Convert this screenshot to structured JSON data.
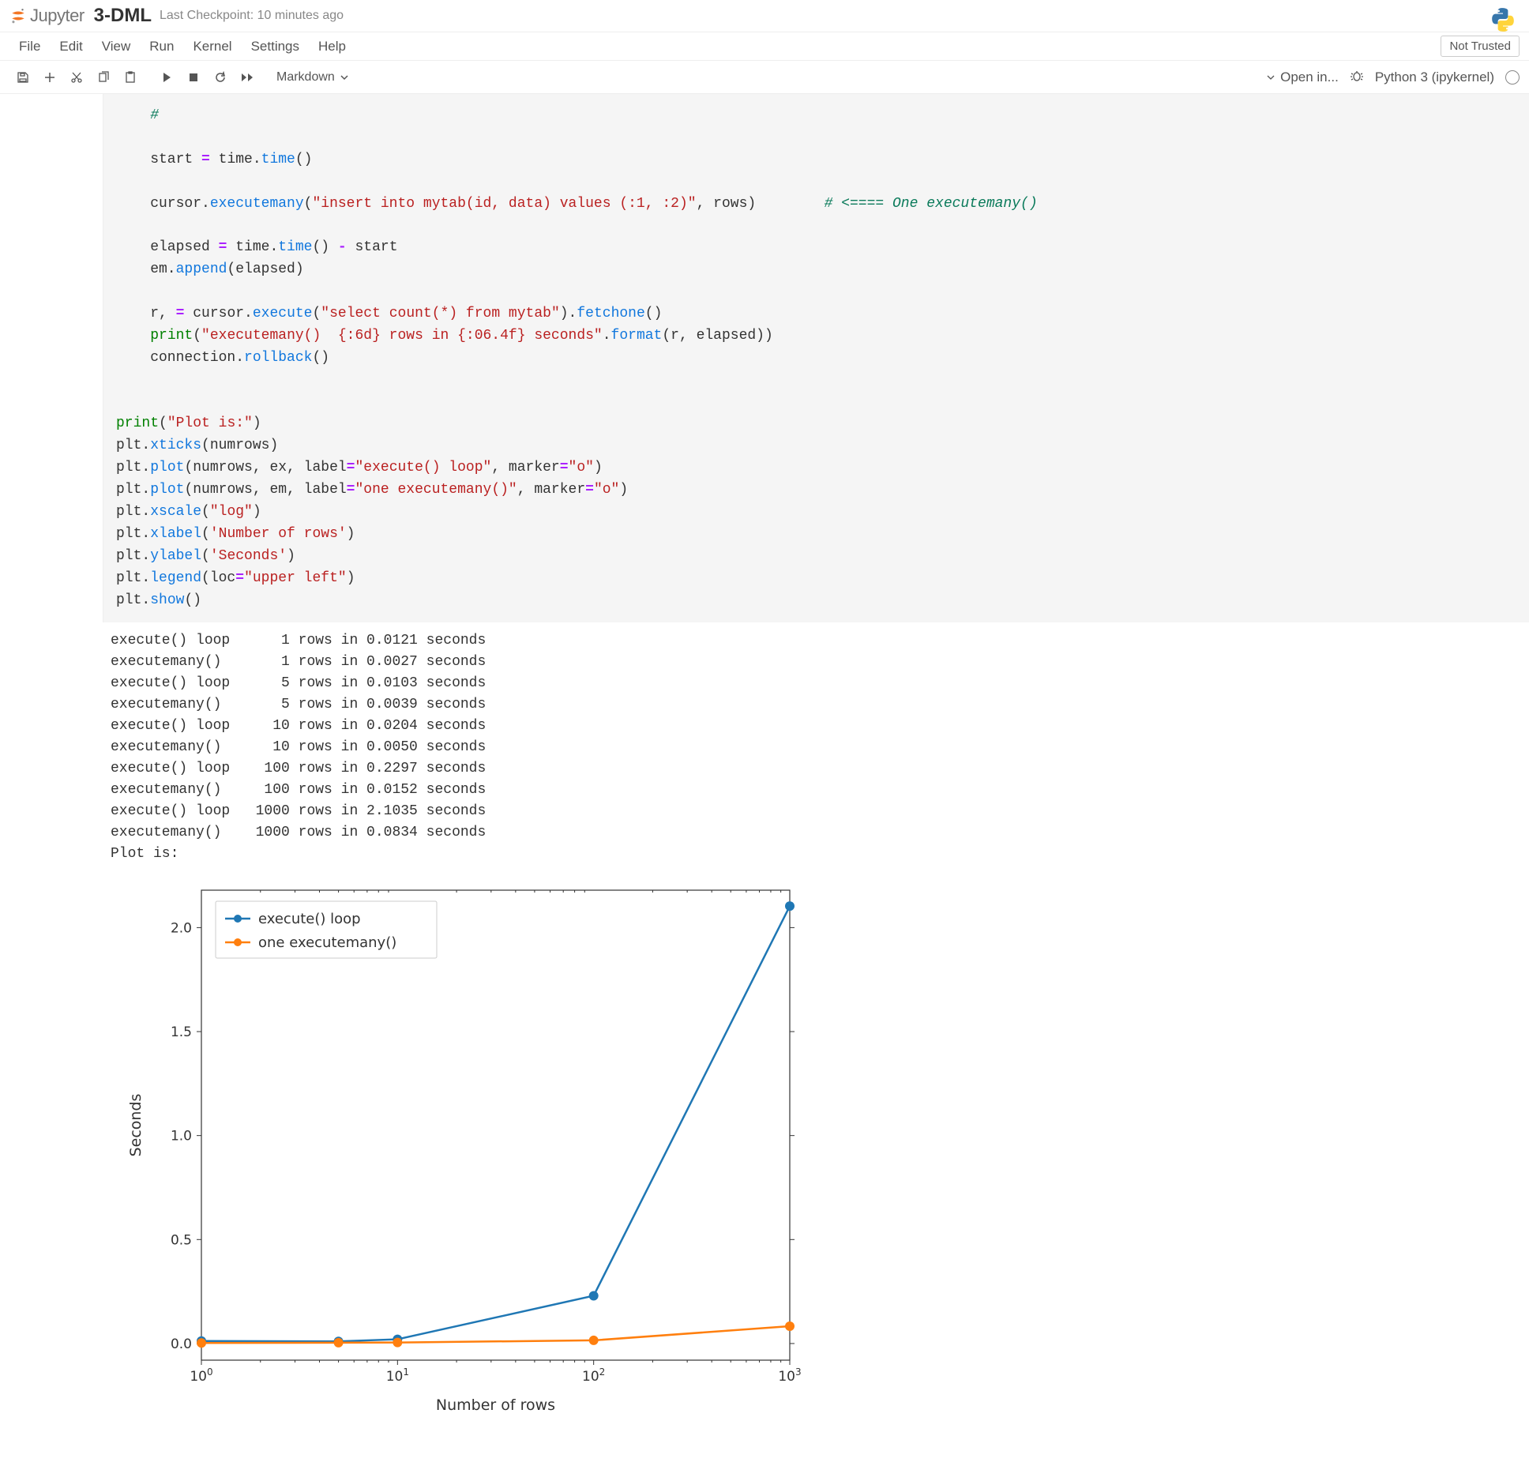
{
  "header": {
    "jupyter_text": "Jupyter",
    "title": "3-DML",
    "checkpoint": "Last Checkpoint: 10 minutes ago"
  },
  "menubar": {
    "items": [
      "File",
      "Edit",
      "View",
      "Run",
      "Kernel",
      "Settings",
      "Help"
    ],
    "not_trusted": "Not Trusted"
  },
  "toolbar": {
    "celltype": "Markdown",
    "openin": "Open in...",
    "kernel": "Python 3 (ipykernel)"
  },
  "code": {
    "c0": "    #",
    "c1a": "    start ",
    "c1b": "=",
    "c1c": " time.",
    "c1d": "time",
    "c1e": "()",
    "c2a": "    cursor.",
    "c2b": "executemany",
    "c2c": "(",
    "c2d": "\"insert into mytab(id, data) values (:1, :2)\"",
    "c2e": ", rows)        ",
    "c2f": "# <==== One executemany()",
    "c3a": "    elapsed ",
    "c3b": "=",
    "c3c": " time.",
    "c3d": "time",
    "c3e": "() ",
    "c3f": "-",
    "c3g": " start",
    "c4a": "    em.",
    "c4b": "append",
    "c4c": "(elapsed)",
    "c5a": "    r, ",
    "c5b": "=",
    "c5c": " cursor.",
    "c5d": "execute",
    "c5e": "(",
    "c5f": "\"select count(*) from mytab\"",
    "c5g": ").",
    "c5h": "fetchone",
    "c5i": "()",
    "c6a": "    ",
    "c6b": "print",
    "c6c": "(",
    "c6d": "\"executemany()  {:6d} rows in {:06.4f} seconds\"",
    "c6e": ".",
    "c6f": "format",
    "c6g": "(r, elapsed))",
    "c7a": "    connection.",
    "c7b": "rollback",
    "c7c": "()",
    "c8a": "print",
    "c8b": "(",
    "c8c": "\"Plot is:\"",
    "c8d": ")",
    "c9a": "plt.",
    "c9b": "xticks",
    "c9c": "(numrows)",
    "c10a": "plt.",
    "c10b": "plot",
    "c10c": "(numrows, ex, label",
    "c10d": "=",
    "c10e": "\"execute() loop\"",
    "c10f": ", marker",
    "c10g": "=",
    "c10h": "\"o\"",
    "c10i": ")",
    "c11a": "plt.",
    "c11b": "plot",
    "c11c": "(numrows, em, label",
    "c11d": "=",
    "c11e": "\"one executemany()\"",
    "c11f": ", marker",
    "c11g": "=",
    "c11h": "\"o\"",
    "c11i": ")",
    "c12a": "plt.",
    "c12b": "xscale",
    "c12c": "(",
    "c12d": "\"log\"",
    "c12e": ")",
    "c13a": "plt.",
    "c13b": "xlabel",
    "c13c": "(",
    "c13d": "'Number of rows'",
    "c13e": ")",
    "c14a": "plt.",
    "c14b": "ylabel",
    "c14c": "(",
    "c14d": "'Seconds'",
    "c14e": ")",
    "c15a": "plt.",
    "c15b": "legend",
    "c15c": "(loc",
    "c15d": "=",
    "c15e": "\"upper left\"",
    "c15f": ")",
    "c16a": "plt.",
    "c16b": "show",
    "c16c": "()"
  },
  "output": {
    "lines": [
      "execute() loop      1 rows in 0.0121 seconds",
      "executemany()       1 rows in 0.0027 seconds",
      "execute() loop      5 rows in 0.0103 seconds",
      "executemany()       5 rows in 0.0039 seconds",
      "execute() loop     10 rows in 0.0204 seconds",
      "executemany()      10 rows in 0.0050 seconds",
      "execute() loop    100 rows in 0.2297 seconds",
      "executemany()     100 rows in 0.0152 seconds",
      "execute() loop   1000 rows in 2.1035 seconds",
      "executemany()    1000 rows in 0.0834 seconds",
      "Plot is:"
    ]
  },
  "chart_data": {
    "type": "line",
    "xscale": "log",
    "xlabel": "Number of rows",
    "ylabel": "Seconds",
    "legend_loc": "upper left",
    "x": [
      1,
      5,
      10,
      100,
      1000
    ],
    "ylim": [
      0,
      2.1
    ],
    "yticks": [
      0.0,
      0.5,
      1.0,
      1.5,
      2.0
    ],
    "xticks_labels": [
      "10⁰",
      "10¹",
      "10²",
      "10³"
    ],
    "series": [
      {
        "name": "execute() loop",
        "color": "#1f77b4",
        "values": [
          0.0121,
          0.0103,
          0.0204,
          0.2297,
          2.1035
        ]
      },
      {
        "name": "one executemany()",
        "color": "#ff7f0e",
        "values": [
          0.0027,
          0.0039,
          0.005,
          0.0152,
          0.0834
        ]
      }
    ]
  }
}
